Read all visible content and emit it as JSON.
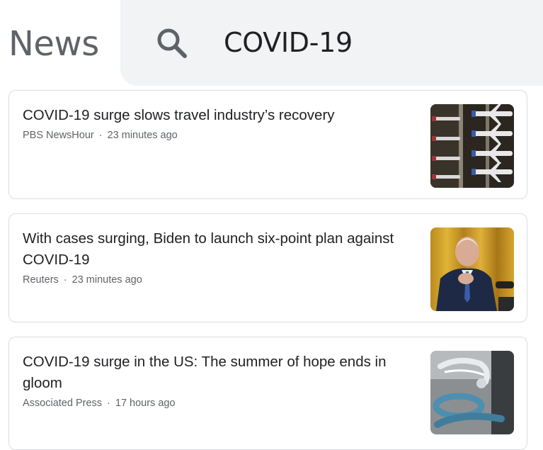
{
  "app": {
    "brand": "News"
  },
  "search": {
    "query": "COVID-19",
    "icon": "search-icon"
  },
  "articles": [
    {
      "title": "COVID-19 surge slows travel industry’s recovery",
      "source": "PBS NewsHour",
      "separator": "·",
      "time": "23 minutes ago",
      "thumbnail": "airplanes-parked-image"
    },
    {
      "title": "With cases surging, Biden to launch six-point plan against COVID-19",
      "source": "Reuters",
      "separator": "·",
      "time": "23 minutes ago",
      "thumbnail": "biden-speaking-image"
    },
    {
      "title": "COVID-19 surge in the US: The summer of hope ends in gloom",
      "source": "Associated Press",
      "separator": "·",
      "time": "17 hours ago",
      "thumbnail": "medical-equipment-image"
    }
  ],
  "colors": {
    "brand_text": "#5f6368",
    "search_bg": "#f1f3f4",
    "title_text": "#202124",
    "meta_text": "#5f6368",
    "card_border": "#dadce0"
  }
}
